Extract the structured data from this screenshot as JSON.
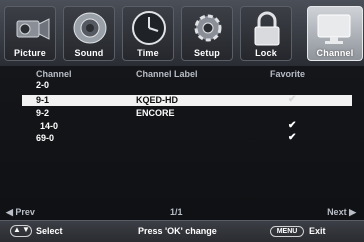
{
  "tabs": [
    {
      "label": "Picture",
      "icon": "camcorder-icon",
      "active": false
    },
    {
      "label": "Sound",
      "icon": "speaker-icon",
      "active": false
    },
    {
      "label": "Time",
      "icon": "clock-icon",
      "active": false
    },
    {
      "label": "Setup",
      "icon": "gear-icon",
      "active": false
    },
    {
      "label": "Lock",
      "icon": "padlock-icon",
      "active": false
    },
    {
      "label": "Channel",
      "icon": "monitor-icon",
      "active": true
    }
  ],
  "columns": {
    "channel": "Channel",
    "label": "Channel Label",
    "favorite": "Favorite"
  },
  "rows": [
    {
      "channel": "2-0",
      "label": "",
      "favorite": ""
    },
    {
      "channel": "9-1",
      "label": "KQED-HD",
      "favorite": "✔"
    },
    {
      "channel": "9-2",
      "label": "ENCORE",
      "favorite": ""
    },
    {
      "channel": "14-0",
      "label": "",
      "favorite": "✔"
    },
    {
      "channel": "69-0",
      "label": "",
      "favorite": "✔"
    }
  ],
  "pager": {
    "prev": "◀ Prev",
    "page": "1/1",
    "next": "Next ▶"
  },
  "footer": {
    "select": "Select",
    "change": "Press 'OK' change",
    "menu_key": "MENU",
    "exit": "Exit"
  }
}
